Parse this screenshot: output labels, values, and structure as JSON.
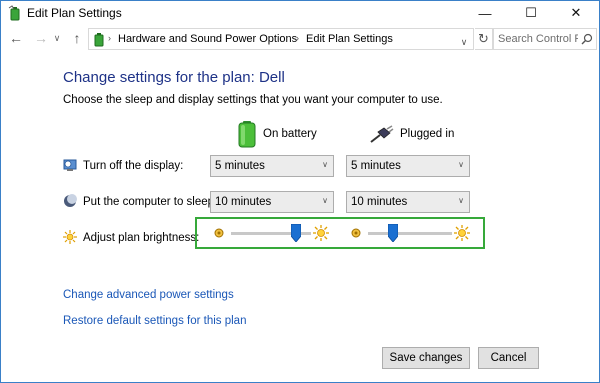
{
  "window": {
    "title": "Edit Plan Settings",
    "minimize_glyph": "—",
    "maximize_glyph": "☐",
    "close_glyph": "✕"
  },
  "nav": {
    "back_glyph": "←",
    "forward_glyph": "→",
    "recent_glyph": "∨",
    "up_glyph": "↑",
    "breadcrumbs": [
      "Hardware and Sound",
      "Power Options",
      "Edit Plan Settings"
    ],
    "separator": "›",
    "refresh_glyph": "↻",
    "search_placeholder": "Search Control P..."
  },
  "main": {
    "heading": "Change settings for the plan: Dell",
    "subtext": "Choose the sleep and display settings that you want your computer to use.",
    "col_battery": "On battery",
    "col_plugged": "Plugged in",
    "rows": [
      {
        "label": "Turn off the display:",
        "battery": "5 minutes",
        "plugged": "5 minutes"
      },
      {
        "label": "Put the computer to sleep:",
        "battery": "10 minutes",
        "plugged": "10 minutes"
      }
    ],
    "brightness_label": "Adjust plan brightness:",
    "brightness_battery_pct": 81,
    "brightness_plugged_pct": 30,
    "highlight_color": "#36a93a"
  },
  "links": {
    "advanced": "Change advanced power settings",
    "restore": "Restore default settings for this plan"
  },
  "buttons": {
    "save": "Save changes",
    "cancel": "Cancel"
  },
  "icons": {
    "title": "power-options-icon",
    "display_row": "monitor-clock-icon",
    "sleep_row": "moon-icon",
    "brightness_row": "sun-icon",
    "battery": "battery-icon",
    "plug": "power-plug-icon",
    "search": "search-icon"
  }
}
